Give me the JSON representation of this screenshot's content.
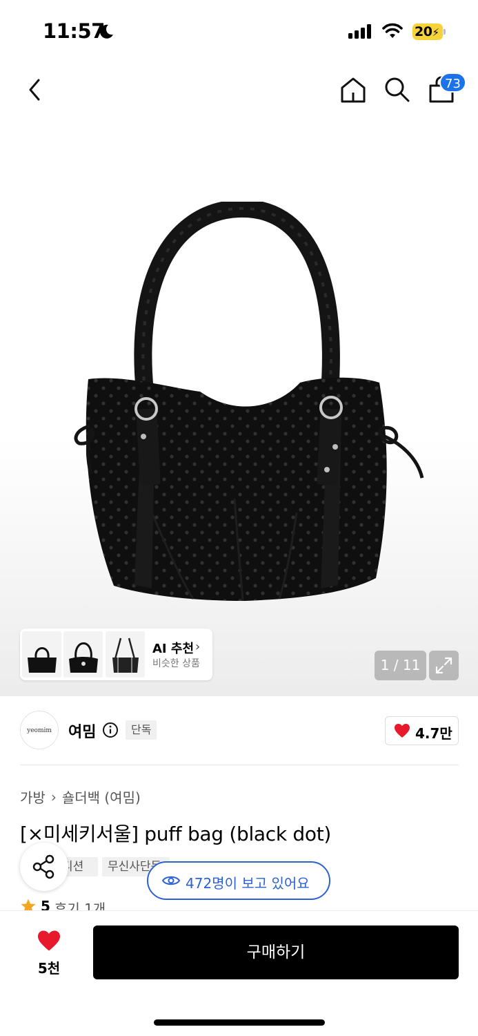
{
  "status_bar": {
    "time": "11:57",
    "battery": "20"
  },
  "nav": {
    "back_icon": "chevron-left-icon",
    "home_icon": "home-icon",
    "search_icon": "search-icon",
    "cart_icon": "shopping-bag-icon",
    "cart_count": "73"
  },
  "gallery": {
    "pager": "1 / 11",
    "ai_title": "AI 추천",
    "ai_subtitle": "비슷한 상품",
    "expand_icon": "expand-icon"
  },
  "brand": {
    "logo_text": "yeomim",
    "name": "여밈",
    "exclusive_label": "단독",
    "likes": "4.7만"
  },
  "breadcrumb": [
    "가방",
    "숄더백 (여밈)"
  ],
  "product": {
    "title": "[×미세키서울] puff bag (black dot)",
    "tags": [
      "디션",
      "무신사단독"
    ],
    "viewers": "472명이 보고 있어요",
    "rating": "5",
    "reviews": "후기 1개"
  },
  "bottom": {
    "wish_count": "5천",
    "buy_label": "구매하기"
  },
  "colors": {
    "accent_blue": "#2b61d4",
    "badge_blue": "#1a73e8",
    "heart_red": "#e8192c",
    "star_orange": "#f5a623",
    "battery_yellow": "#f7d33a"
  }
}
